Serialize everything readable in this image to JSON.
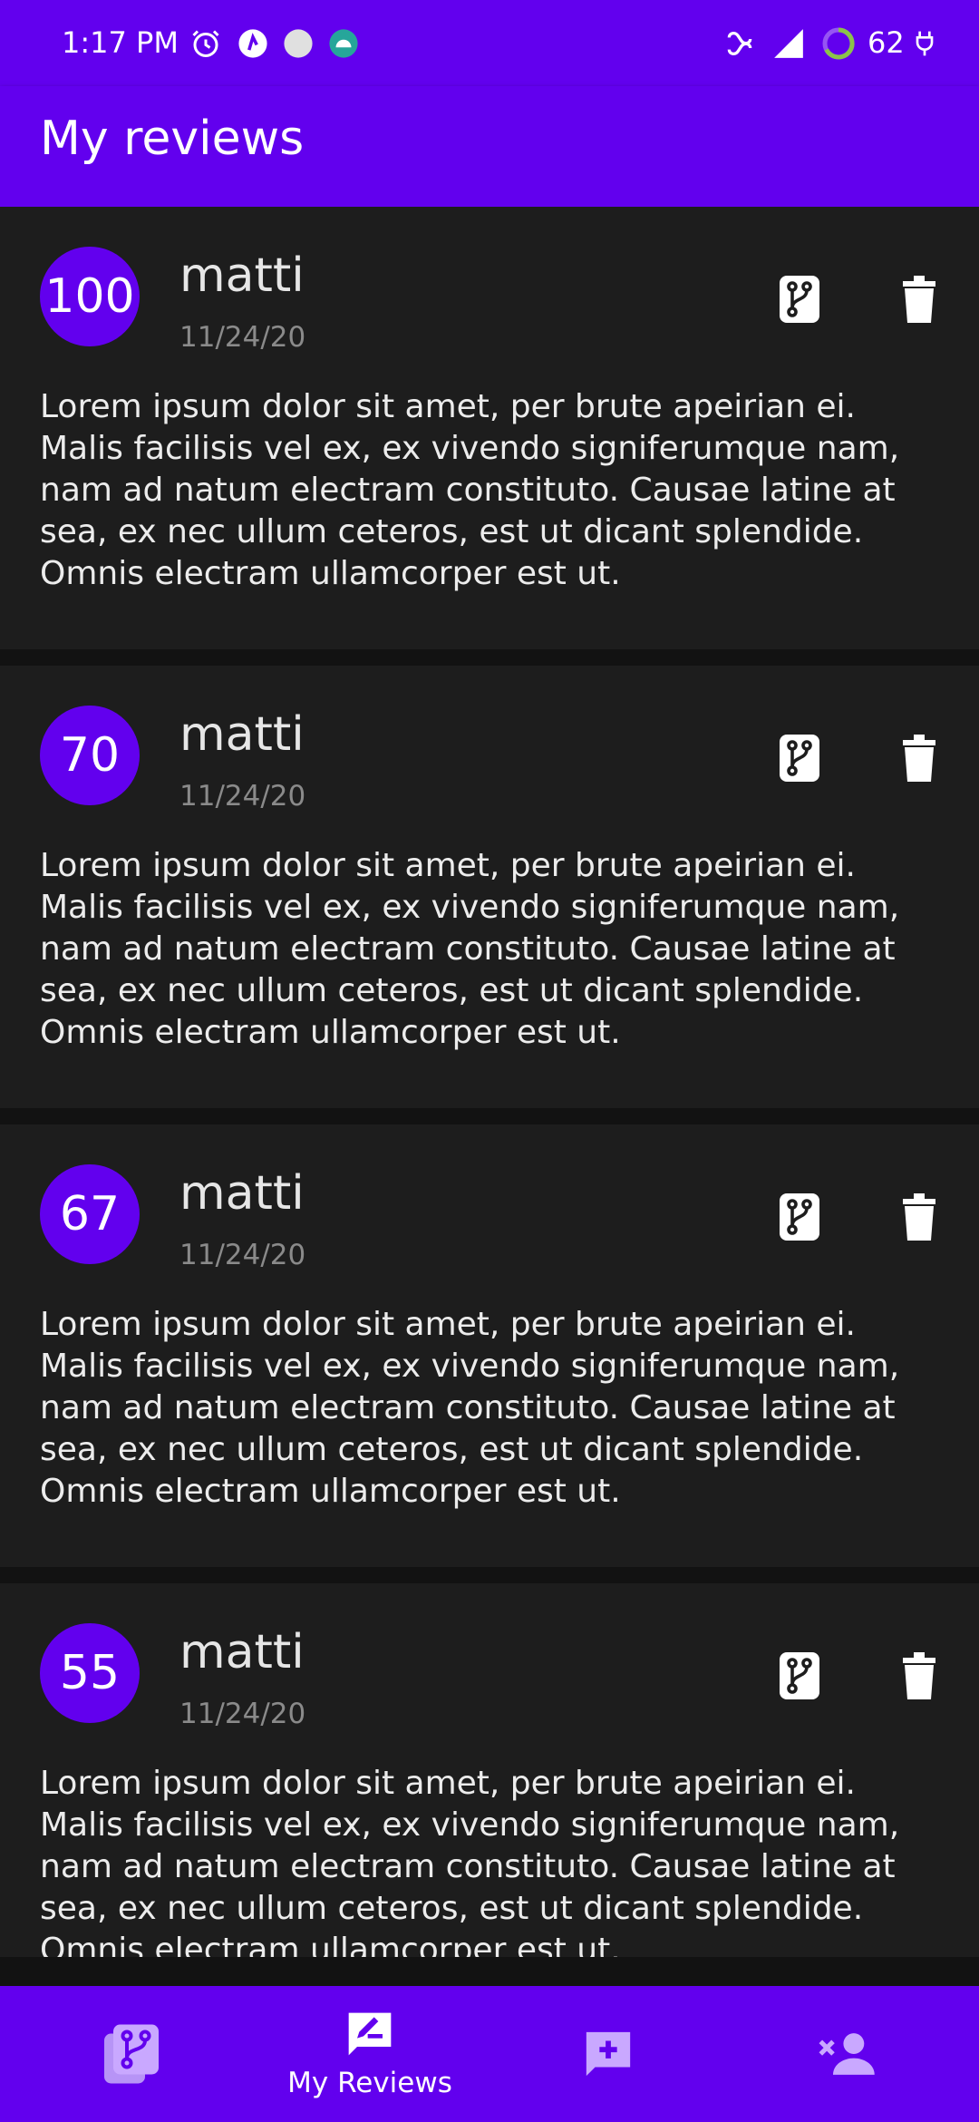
{
  "status_bar": {
    "time": "1:17 PM",
    "battery": "62",
    "icons": [
      "alarm-icon",
      "app-notification-icon",
      "circle-notification-icon",
      "android-notification-icon",
      "link-icon",
      "signal-icon",
      "battery-ring-icon",
      "charging-plug-icon"
    ]
  },
  "app_bar": {
    "title": "My reviews"
  },
  "reviews": [
    {
      "score": "100",
      "author": "matti",
      "date": "11/24/20",
      "text": "Lorem ipsum dolor sit amet, per brute apeirian ei. Malis facilisis vel ex, ex vivendo signiferumque nam, nam ad natum electram constituto. Causae latine at sea, ex nec ullum ceteros, est ut dicant splendide. Omnis electram ullamcorper est ut."
    },
    {
      "score": "70",
      "author": "matti",
      "date": "11/24/20",
      "text": "Lorem ipsum dolor sit amet, per brute apeirian ei. Malis facilisis vel ex, ex vivendo signiferumque nam, nam ad natum electram constituto. Causae latine at sea, ex nec ullum ceteros, est ut dicant splendide. Omnis electram ullamcorper est ut."
    },
    {
      "score": "67",
      "author": "matti",
      "date": "11/24/20",
      "text": "Lorem ipsum dolor sit amet, per brute apeirian ei. Malis facilisis vel ex, ex vivendo signiferumque nam, nam ad natum electram constituto. Causae latine at sea, ex nec ullum ceteros, est ut dicant splendide. Omnis electram ullamcorper est ut."
    },
    {
      "score": "55",
      "author": "matti",
      "date": "11/24/20",
      "text": "Lorem ipsum dolor sit amet, per brute apeirian ei. Malis facilisis vel ex, ex vivendo signiferumque nam, nam ad natum electram constituto. Causae latine at sea, ex nec ullum ceteros, est ut dicant splendide. Omnis electram ullamcorper est ut."
    }
  ],
  "bottom_nav": {
    "items": [
      {
        "icon": "branch-list-icon",
        "label": ""
      },
      {
        "icon": "write-review-icon",
        "label": "My Reviews",
        "selected": true
      },
      {
        "icon": "add-comment-icon",
        "label": ""
      },
      {
        "icon": "remove-user-icon",
        "label": ""
      }
    ]
  },
  "colors": {
    "primary": "#6200ee",
    "background": "#121212",
    "card": "#1d1d1d"
  }
}
